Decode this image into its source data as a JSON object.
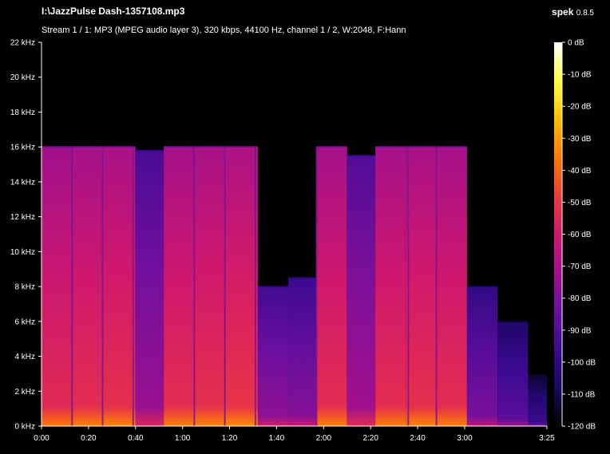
{
  "header": {
    "file_title": "I:\\JazzPulse Dash-1357108.mp3",
    "stream_info": "Stream 1 / 1: MP3 (MPEG audio layer 3), 320 kbps, 44100 Hz, channel 1 / 2, W:2048, F:Hann",
    "app_name": "spek",
    "app_version": "0.8.5"
  },
  "chart_data": {
    "type": "heatmap",
    "title": "",
    "xlabel": "",
    "ylabel": "",
    "x_unit": "time (m:ss)",
    "xlim": [
      0,
      215
    ],
    "x_ticks": [
      {
        "value": 0,
        "label": "0:00"
      },
      {
        "value": 20,
        "label": "0:20"
      },
      {
        "value": 40,
        "label": "0:40"
      },
      {
        "value": 60,
        "label": "1:00"
      },
      {
        "value": 80,
        "label": "1:20"
      },
      {
        "value": 100,
        "label": "1:40"
      },
      {
        "value": 120,
        "label": "2:00"
      },
      {
        "value": 140,
        "label": "2:20"
      },
      {
        "value": 160,
        "label": "2:40"
      },
      {
        "value": 180,
        "label": "3:00"
      },
      {
        "value": 215,
        "label": "3:25"
      }
    ],
    "ylim": [
      0,
      22
    ],
    "y_ticks": [
      {
        "value": 0,
        "label": "0 kHz"
      },
      {
        "value": 2,
        "label": "2 kHz"
      },
      {
        "value": 4,
        "label": "4 kHz"
      },
      {
        "value": 6,
        "label": "6 kHz"
      },
      {
        "value": 8,
        "label": "8 kHz"
      },
      {
        "value": 10,
        "label": "10 kHz"
      },
      {
        "value": 12,
        "label": "12 kHz"
      },
      {
        "value": 14,
        "label": "14 kHz"
      },
      {
        "value": 16,
        "label": "16 kHz"
      },
      {
        "value": 18,
        "label": "18 kHz"
      },
      {
        "value": 20,
        "label": "20 kHz"
      },
      {
        "value": 22,
        "label": "22 kHz"
      }
    ],
    "colorbar": {
      "range_db": [
        -120,
        0
      ],
      "ticks": [
        "0 dB",
        "-10 dB",
        "-20 dB",
        "-30 dB",
        "-40 dB",
        "-50 dB",
        "-60 dB",
        "-70 dB",
        "-80 dB",
        "-90 dB",
        "-100 dB",
        "-110 dB",
        "-120 dB"
      ],
      "colors": [
        "#ffffff",
        "#ffff40",
        "#ffc000",
        "#ff7800",
        "#f03c3c",
        "#d0186c",
        "#a0108c",
        "#6a10a0",
        "#3a0a90",
        "#180860",
        "#000000"
      ]
    },
    "segments": [
      {
        "start": 0,
        "end": 13,
        "cutoff_khz": 16.0,
        "level_db": -58
      },
      {
        "start": 13,
        "end": 26,
        "cutoff_khz": 16.0,
        "level_db": -57
      },
      {
        "start": 26,
        "end": 40,
        "cutoff_khz": 16.0,
        "level_db": -56
      },
      {
        "start": 40,
        "end": 52,
        "cutoff_khz": 15.8,
        "level_db": -78
      },
      {
        "start": 52,
        "end": 65,
        "cutoff_khz": 16.0,
        "level_db": -57
      },
      {
        "start": 65,
        "end": 78,
        "cutoff_khz": 16.0,
        "level_db": -56
      },
      {
        "start": 78,
        "end": 92,
        "cutoff_khz": 16.0,
        "level_db": -55
      },
      {
        "start": 92,
        "end": 105,
        "cutoff_khz": 8.0,
        "level_db": -80
      },
      {
        "start": 105,
        "end": 117,
        "cutoff_khz": 8.5,
        "level_db": -82
      },
      {
        "start": 117,
        "end": 130,
        "cutoff_khz": 16.0,
        "level_db": -57
      },
      {
        "start": 130,
        "end": 142,
        "cutoff_khz": 15.5,
        "level_db": -76
      },
      {
        "start": 142,
        "end": 155,
        "cutoff_khz": 16.0,
        "level_db": -57
      },
      {
        "start": 155,
        "end": 168,
        "cutoff_khz": 16.0,
        "level_db": -56
      },
      {
        "start": 168,
        "end": 181,
        "cutoff_khz": 16.0,
        "level_db": -57
      },
      {
        "start": 181,
        "end": 194,
        "cutoff_khz": 8.0,
        "level_db": -85
      },
      {
        "start": 194,
        "end": 207,
        "cutoff_khz": 6.0,
        "level_db": -92
      },
      {
        "start": 207,
        "end": 215,
        "cutoff_khz": 3.0,
        "level_db": -100
      }
    ],
    "transients": [
      13,
      26,
      39,
      65,
      78,
      91,
      117,
      156,
      168
    ]
  }
}
